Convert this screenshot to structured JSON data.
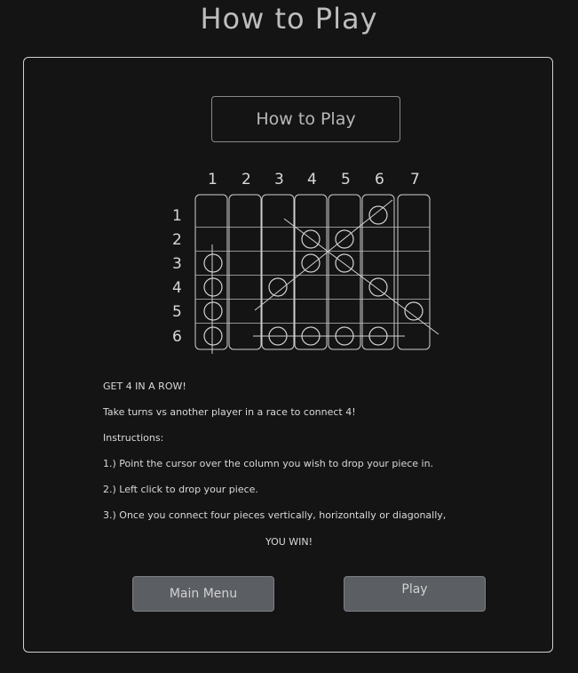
{
  "header": {
    "title": "How to Play"
  },
  "panel": {
    "heading": "How to Play",
    "diagram": {
      "column_labels": [
        "1",
        "2",
        "3",
        "4",
        "5",
        "6",
        "7"
      ],
      "row_labels": [
        "1",
        "2",
        "3",
        "4",
        "5",
        "6"
      ],
      "pieces": [
        {
          "col": 6,
          "row": 1
        },
        {
          "col": 4,
          "row": 2
        },
        {
          "col": 5,
          "row": 2
        },
        {
          "col": 1,
          "row": 3
        },
        {
          "col": 4,
          "row": 3
        },
        {
          "col": 5,
          "row": 3
        },
        {
          "col": 1,
          "row": 4
        },
        {
          "col": 3,
          "row": 4
        },
        {
          "col": 6,
          "row": 4
        },
        {
          "col": 1,
          "row": 5
        },
        {
          "col": 7,
          "row": 5
        },
        {
          "col": 1,
          "row": 6
        },
        {
          "col": 3,
          "row": 6
        },
        {
          "col": 4,
          "row": 6
        },
        {
          "col": 5,
          "row": 6
        },
        {
          "col": 6,
          "row": 6
        }
      ]
    },
    "instructions": {
      "headline": "GET 4 IN A ROW!",
      "intro": "Take turns vs another player in a race to connect 4!",
      "label": "Instructions:",
      "step1": "1.) Point the cursor over the column you wish to drop your piece in.",
      "step2": "2.) Left click to drop your piece.",
      "step3": "3.) Once you connect four pieces vertically, horizontally or diagonally,",
      "win": "YOU WIN!"
    },
    "buttons": {
      "main_menu": "Main Menu",
      "play": "Play"
    }
  }
}
